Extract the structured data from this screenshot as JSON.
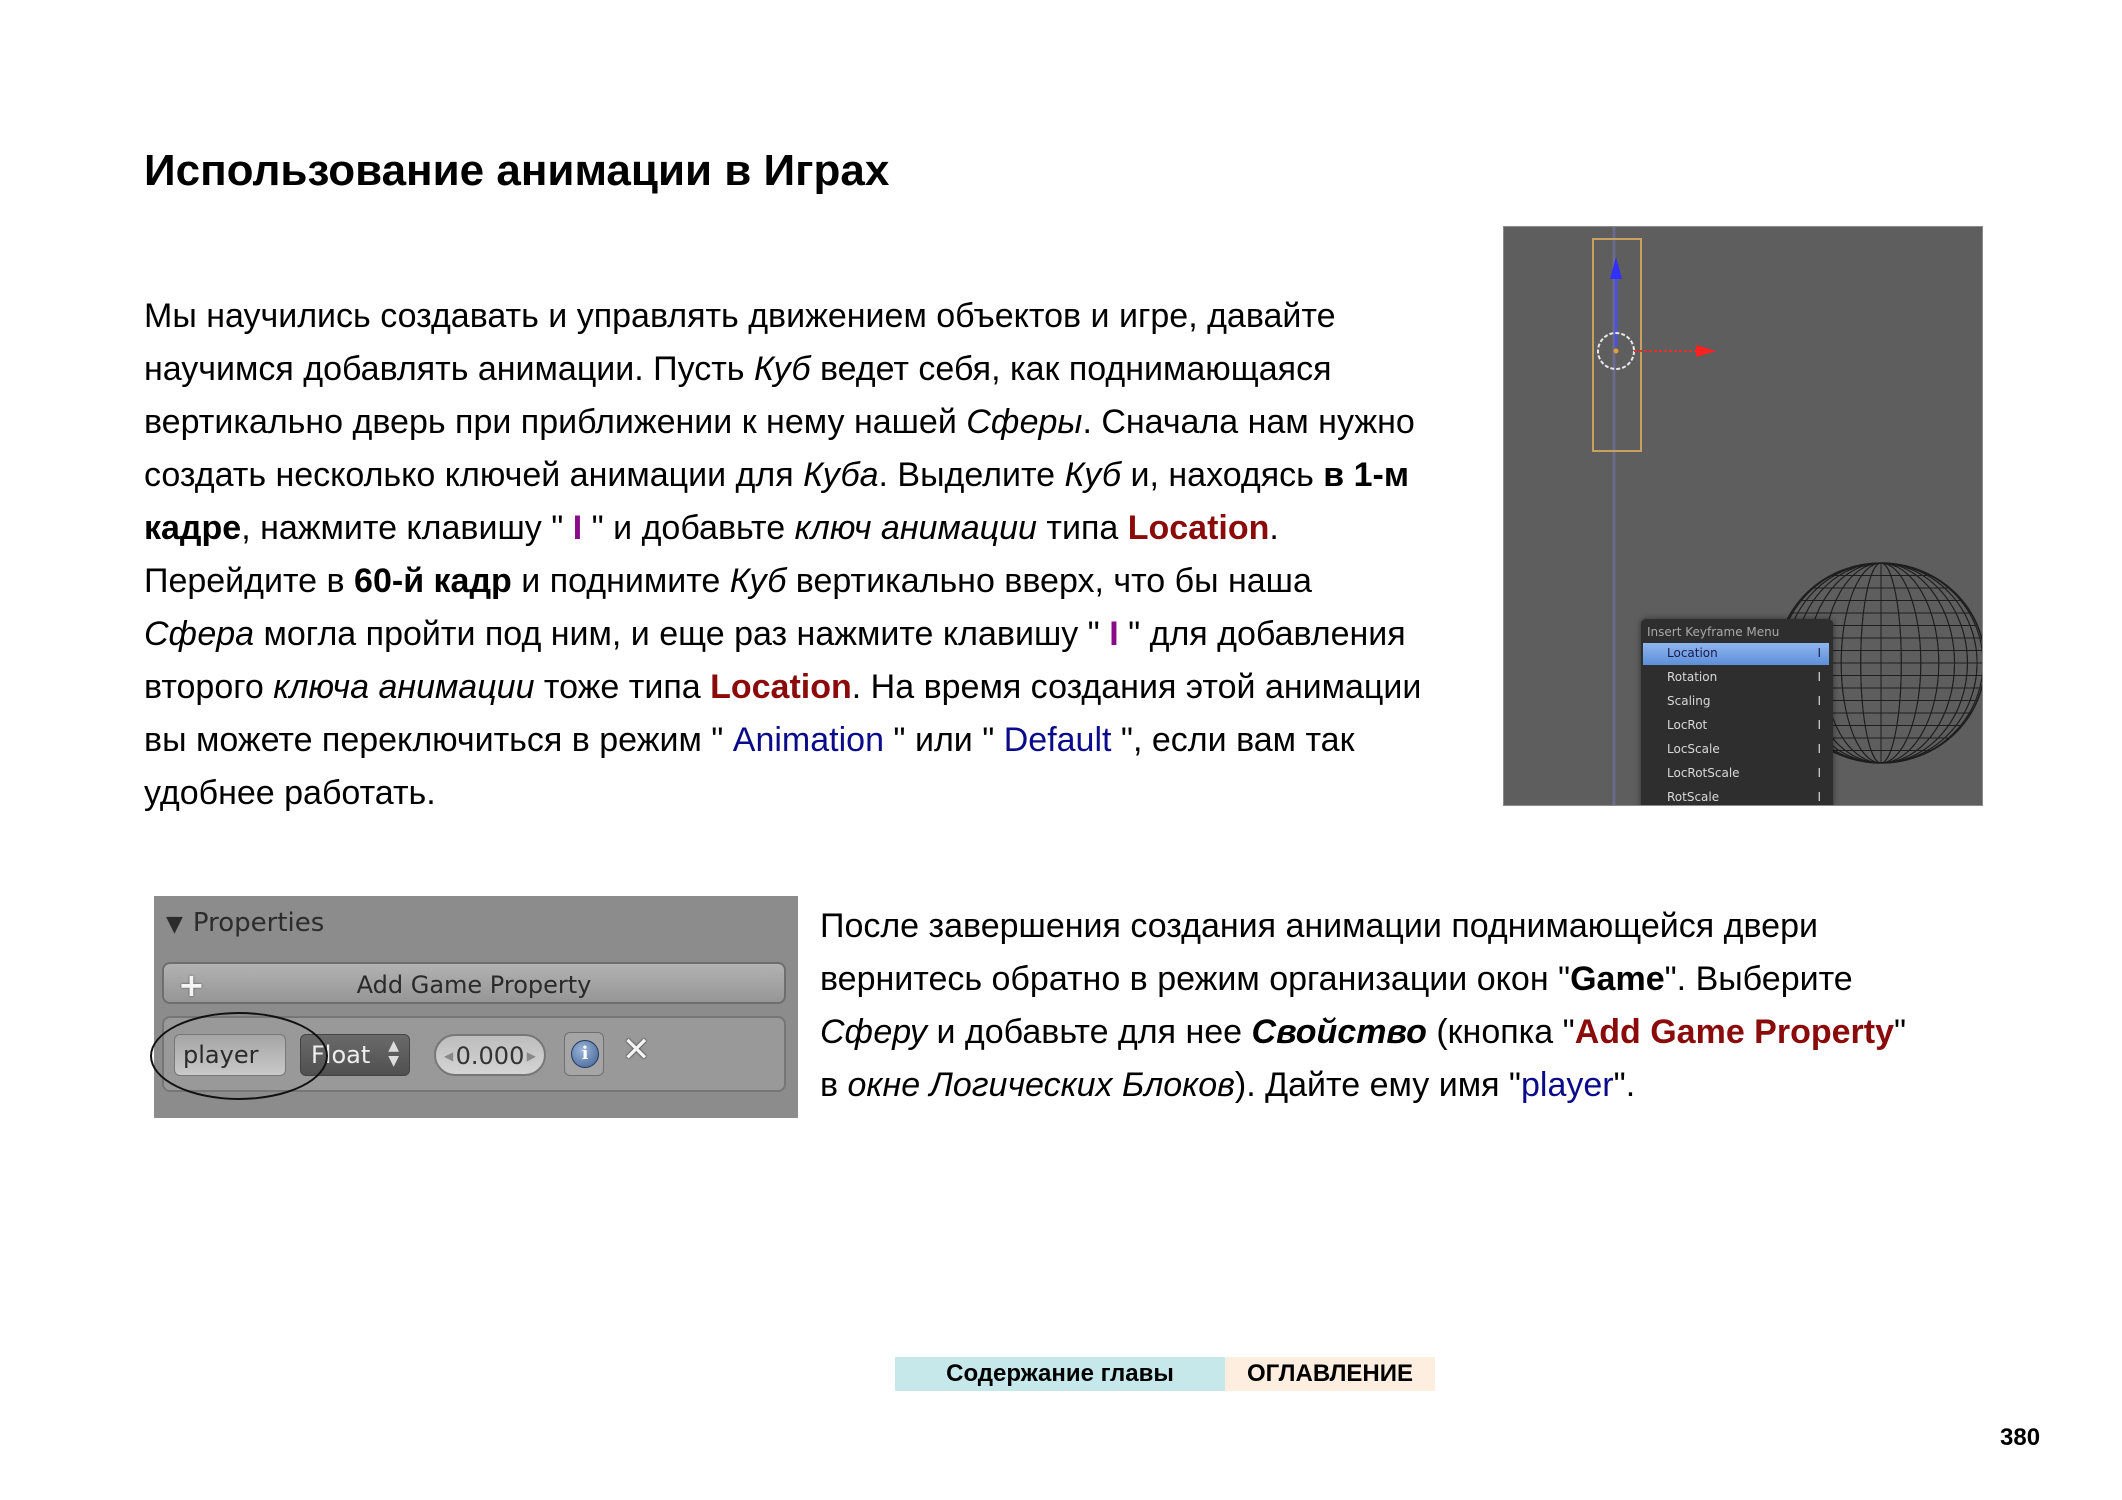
{
  "title": "Использование анимации в Играх",
  "para1": {
    "l1": "Мы научились создавать и управлять движением объектов и игре, давайте",
    "l2a": "научимся добавлять анимации. Пусть ",
    "l2b": "Куб",
    "l2c": " ведет себя, как поднимающаяся",
    "l3a": "вертикально дверь при приближении к нему нашей ",
    "l3b": "Сферы",
    "l3c": ". Сначала нам нужно",
    "l4a": "создать несколько ключей анимации для ",
    "l4b": "Куба",
    "l4c": ". Выделите ",
    "l4d": "Куб",
    "l4e": " и, находясь ",
    "l4f": "в 1-м",
    "l5a": "кадре",
    "l5b": ", нажмите клавишу \" ",
    "l5c": "I",
    "l5d": " \" и добавьте ",
    "l5e": "ключ анимации",
    "l5f": " типа ",
    "l5g": "Location",
    "l5h": ".",
    "l6a": "Перейдите в ",
    "l6b": "60-й кадр",
    "l6c": " и поднимите ",
    "l6d": "Куб",
    "l6e": " вертикально вверх, что бы наша",
    "l7a": "Сфера",
    "l7b": " могла пройти под ним, и еще раз нажмите клавишу \" ",
    "l7c": "I",
    "l7d": " \" для добавления",
    "l8a": "второго ",
    "l8b": "ключа анимации",
    "l8c": " тоже типа ",
    "l8d": "Location",
    "l8e": ". На время создания этой анимации",
    "l9a": "вы можете переключиться в режим \" ",
    "l9b": "Animation",
    "l9c": " \" или \" ",
    "l9d": "Default",
    "l9e": " \", если вам так",
    "l10": "удобнее работать."
  },
  "para2": {
    "l1": "После завершения создания анимации поднимающейся двери",
    "l2a": "вернитесь обратно в режим организации окон \"",
    "l2b": "Game",
    "l2c": "\". Выберите",
    "l3a": "Сферу",
    "l3b": " и добавьте для нее ",
    "l3c": "Свойство",
    "l3d": " (кнопка \"",
    "l3e": "Add Game Property",
    "l3f": "\"",
    "l4a": "в ",
    "l4b": "окне Логических Блоков",
    "l4c": "). Дайте ему имя \"",
    "l4d": "player",
    "l4e": "\"."
  },
  "viewport": {
    "menu_title": "Insert Keyframe Menu",
    "menu_items": [
      {
        "label": "Location",
        "key": "I",
        "selected": true
      },
      {
        "label": "Rotation",
        "key": "I"
      },
      {
        "label": "Scaling",
        "key": "I"
      },
      {
        "label": "LocRot",
        "key": "I"
      },
      {
        "label": "LocScale",
        "key": "I"
      },
      {
        "label": "LocRotScale",
        "key": "I"
      },
      {
        "label": "RotScale",
        "key": "I"
      }
    ]
  },
  "properties_panel": {
    "header": "Properties",
    "collapse_glyph": "▼",
    "add_button": "Add Game Property",
    "add_glyph": "+",
    "name_value": "player",
    "type_value": "Float",
    "number_value": "0.000",
    "info_glyph": "i",
    "delete_glyph": "✕"
  },
  "footer": {
    "chapter_link": "Содержание главы",
    "toc_link": "ОГЛАВЛЕНИЕ",
    "page_number": "380"
  },
  "colors": {
    "keyword_red": "#8b0a0a",
    "keyword_purple": "#8a0b8a",
    "keyword_blue": "#0a0a8b",
    "chapter_bg": "#c6e8ea",
    "toc_bg": "#fdeee0"
  }
}
